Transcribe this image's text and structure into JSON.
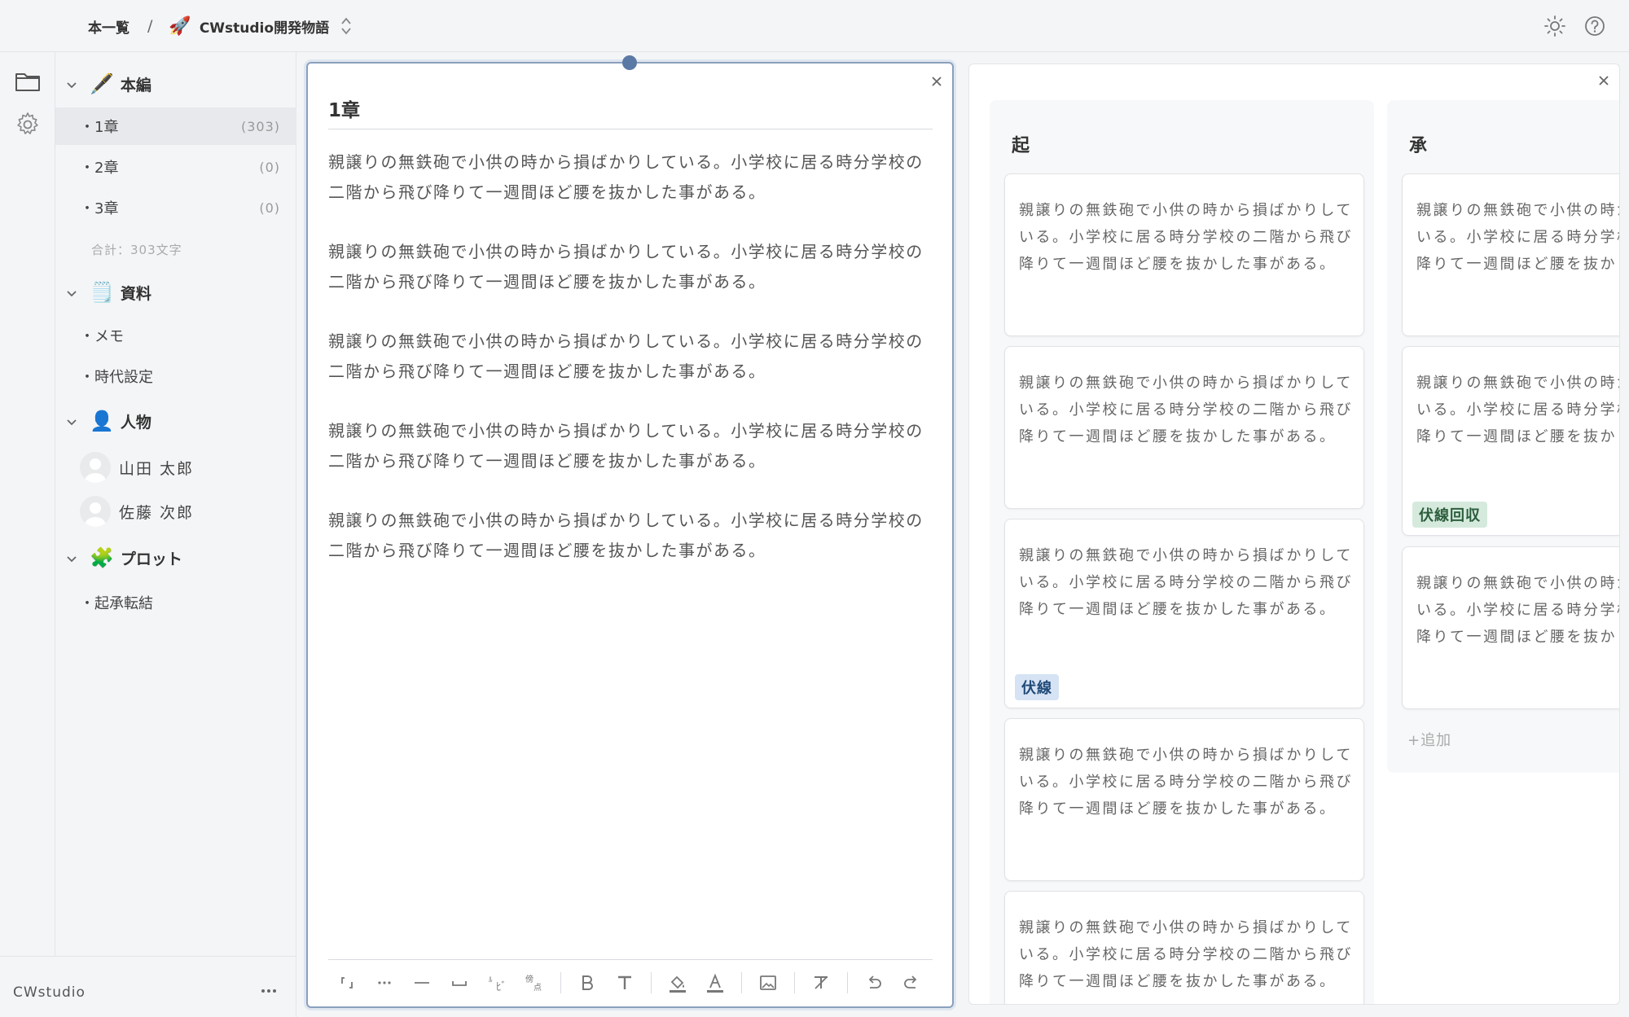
{
  "header": {
    "breadcrumb_root": "本一覧",
    "separator": "/",
    "project_emoji": "🚀",
    "project_name": "CWstudio開発物語"
  },
  "sidebar": {
    "sections": [
      {
        "emoji": "🖋️",
        "label": "本編"
      },
      {
        "emoji": "🗒️",
        "label": "資料"
      },
      {
        "emoji": "👤",
        "label": "人物"
      },
      {
        "emoji": "🧩",
        "label": "プロット"
      }
    ],
    "chapters": [
      {
        "label": "・1章",
        "count": "(303)"
      },
      {
        "label": "・2章",
        "count": "(0)"
      },
      {
        "label": "・3章",
        "count": "(0)"
      }
    ],
    "total": "合計：303文字",
    "materials": [
      {
        "label": "・メモ"
      },
      {
        "label": "・時代設定"
      }
    ],
    "people": [
      {
        "name": "山田 太郎"
      },
      {
        "name": "佐藤 次郎"
      }
    ],
    "plots": [
      {
        "label": "・起承転結"
      }
    ]
  },
  "bottombar": {
    "app_name": "CWstudio",
    "more": "•••"
  },
  "editor": {
    "title": "1章",
    "paragraphs": [
      "親譲りの無鉄砲で小供の時から損ばかりしている。小学校に居る時分学校の二階から飛び降りて一週間ほど腰を抜かした事がある。",
      "親譲りの無鉄砲で小供の時から損ばかりしている。小学校に居る時分学校の二階から飛び降りて一週間ほど腰を抜かした事がある。",
      "親譲りの無鉄砲で小供の時から損ばかりしている。小学校に居る時分学校の二階から飛び降りて一週間ほど腰を抜かした事がある。",
      "親譲りの無鉄砲で小供の時から損ばかりしている。小学校に居る時分学校の二階から飛び降りて一週間ほど腰を抜かした事がある。",
      "親譲りの無鉄砲で小供の時から損ばかりしている。小学校に居る時分学校の二階から飛び降りて一週間ほど腰を抜かした事がある。"
    ],
    "toolbar": {
      "bracket": "「」",
      "ellipsis": "•••",
      "dash": "—",
      "space": "⎵",
      "ruby": "ﾙﾋﾞ",
      "emphasis": "傍点",
      "bold": "B",
      "text": "T",
      "color": "A"
    }
  },
  "plot": {
    "columns": [
      {
        "title": "起",
        "cards": [
          {
            "text": "親譲りの無鉄砲で小供の時から損ばかりしている。小学校に居る時分学校の二階から飛び降りて一週間ほど腰を抜かした事がある。",
            "tag": ""
          },
          {
            "text": "親譲りの無鉄砲で小供の時から損ばかりしている。小学校に居る時分学校の二階から飛び降りて一週間ほど腰を抜かした事がある。",
            "tag": ""
          },
          {
            "text": "親譲りの無鉄砲で小供の時から損ばかりしている。小学校に居る時分学校の二階から飛び降りて一週間ほど腰を抜かした事がある。",
            "tag": "伏線"
          },
          {
            "text": "親譲りの無鉄砲で小供の時から損ばかりしている。小学校に居る時分学校の二階から飛び降りて一週間ほど腰を抜かした事がある。",
            "tag": ""
          },
          {
            "text": "親譲りの無鉄砲で小供の時から損ばかりしている。小学校に居る時分学校の二階から飛び降りて一週間ほど腰を抜かした事がある。",
            "tag": ""
          }
        ]
      },
      {
        "title": "承",
        "cards": [
          {
            "text": "親譲りの無鉄砲で小供の時から損ばかりしている。小学校に居る時分学校の二階から飛び降りて一週間ほど腰を抜かした事がある。",
            "tag": ""
          },
          {
            "text": "親譲りの無鉄砲で小供の時から損ばかりしている。小学校に居る時分学校の二階から飛び降りて一週間ほど腰を抜かした事がある。",
            "tag": "伏線回収"
          },
          {
            "text": "親譲りの無鉄砲で小供の時から損ばかりしている。小学校に居る時分学校の二階から飛び降りて一週間ほど腰を抜かした事がある。",
            "tag": ""
          }
        ],
        "add_label": "+追加"
      }
    ]
  },
  "colors": {
    "accent": "#5b79a5",
    "tag_blue_bg": "#d6e3f4",
    "tag_green_bg": "#d5eadd"
  }
}
